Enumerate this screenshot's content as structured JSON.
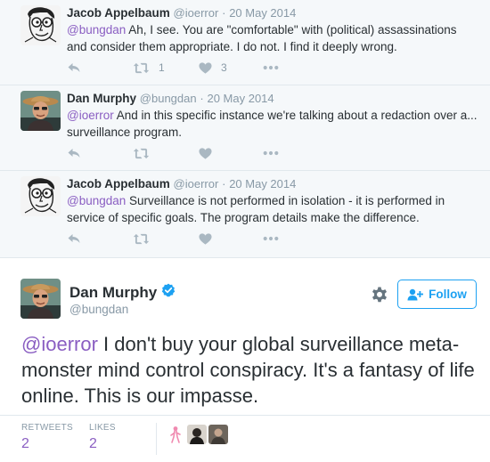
{
  "conversation": [
    {
      "avatar_icon": "cartoon-face-avatar-icon",
      "name": "Jacob Appelbaum",
      "screen_name": "@ioerror",
      "date": "20 May 2014",
      "mention": "@bungdan",
      "text": " Ah, I see. You are \"comfortable\" with (political) assassinations and consider them appropriate. I do not. I find it deeply wrong.",
      "retweets": "1",
      "likes": "3"
    },
    {
      "avatar_icon": "man-with-hat-avatar-icon",
      "name": "Dan Murphy",
      "screen_name": "@bungdan",
      "date": "20 May 2014",
      "mention": "@ioerror",
      "text": " And in this specific instance we're talking about a redaction over a... surveillance program.",
      "retweets": "",
      "likes": ""
    },
    {
      "avatar_icon": "cartoon-face-avatar-icon",
      "name": "Jacob Appelbaum",
      "screen_name": "@ioerror",
      "date": "20 May 2014",
      "mention": "@bungdan",
      "text": " Surveillance is not performed in isolation - it is performed in service of specific goals. The program details make the difference.",
      "retweets": "",
      "likes": ""
    }
  ],
  "main_tweet": {
    "name": "Dan Murphy",
    "screen_name": "@bungdan",
    "follow_label": "Follow",
    "mention": "@ioerror",
    "text": " I don't buy your global surveillance meta-monster mind control conspiracy. It's a fantasy of life online. This is our impasse.",
    "retweets_label": "RETWEETS",
    "retweets": "2",
    "likes_label": "LIKES",
    "likes": "2"
  },
  "colors": {
    "accent": "#1da1f2",
    "mention": "#8a5ec2",
    "muted": "#8899a6",
    "icon": "#aab8c2",
    "convo_bg": "#f5f8fa"
  }
}
